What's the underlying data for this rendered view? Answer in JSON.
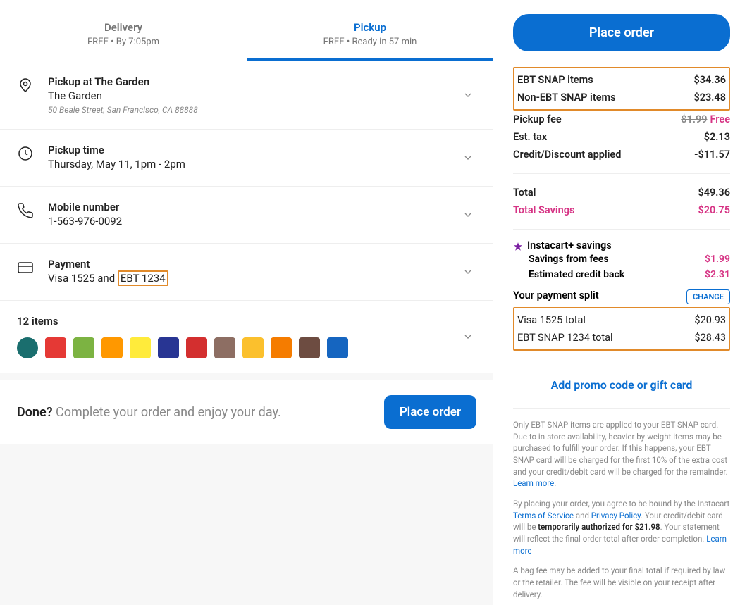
{
  "tabs": {
    "delivery": {
      "title": "Delivery",
      "sub": "FREE • By 7:05pm"
    },
    "pickup": {
      "title": "Pickup",
      "sub": "FREE • Ready in 57 min"
    }
  },
  "pickup_location": {
    "title": "Pickup at The Garden",
    "store": "The Garden",
    "address": "50 Beale Street, San Francisco, CA 88888"
  },
  "pickup_time": {
    "title": "Pickup time",
    "value": "Thursday, May 11, 1pm - 2pm"
  },
  "mobile": {
    "title": "Mobile number",
    "value": "1-563-976-0092"
  },
  "payment": {
    "title": "Payment",
    "prefix": "Visa 1525 and ",
    "highlight": "EBT 1234"
  },
  "items": {
    "title": "12 items",
    "colors": [
      "#1a6e6e",
      "#e53935",
      "#7cb342",
      "#ff9800",
      "#ffeb3b",
      "#283593",
      "#d32f2f",
      "#8d6e63",
      "#fbc02d",
      "#f57c00",
      "#6d4c41",
      "#1565c0"
    ]
  },
  "done": {
    "label": "Done? ",
    "text": "Complete your order and enjoy your day.",
    "button": "Place order"
  },
  "sidebar": {
    "place_order": "Place order",
    "ebt_snap": {
      "label": "EBT SNAP items",
      "val": "$34.36"
    },
    "non_ebt": {
      "label": "Non-EBT SNAP items",
      "val": "$23.48"
    },
    "pickup_fee": {
      "label": "Pickup fee",
      "strike": "$1.99",
      "val": "Free"
    },
    "est_tax": {
      "label": "Est. tax",
      "val": "$2.13"
    },
    "credit": {
      "label": "Credit/Discount applied",
      "val": "-$11.57"
    },
    "total": {
      "label": "Total",
      "val": "$49.36"
    },
    "savings": {
      "label": "Total Savings",
      "val": "$20.75"
    },
    "instacart_plus": "Instacart+ savings",
    "savings_fees": {
      "label": "Savings from fees",
      "val": "$1.99"
    },
    "credit_back": {
      "label": "Estimated credit back",
      "val": "$2.31"
    },
    "payment_split": "Your payment split",
    "change": "CHANGE",
    "visa_total": {
      "label": "Visa 1525 total",
      "val": "$20.93"
    },
    "ebt_total": {
      "label": "EBT SNAP 1234 total",
      "val": "$28.43"
    },
    "promo": "Add promo code or gift card"
  },
  "disclaimers": {
    "p1": "Only EBT SNAP items are applied to your EBT SNAP card. Due to in-store availability, heavier by-weight items may be purchased to fulfill your order. If this happens, your EBT SNAP card will be charged for the first 10% of the extra cost and your credit/debit card will be charged for the remainder. ",
    "learn_more": "Learn more",
    "p2a": "By placing your order, you agree to be bound by the Instacart ",
    "tos": "Terms of Service",
    "and": " and ",
    "pp": "Privacy Policy",
    "p2b": ". Your credit/debit card will be ",
    "auth": "temporarily authorized for $21.98",
    "p2c": ". Your statement will reflect the final order total after order completion. ",
    "p3": "A bag fee may be added to your final total if required by law or the retailer. The fee will be visible on your receipt after delivery."
  }
}
